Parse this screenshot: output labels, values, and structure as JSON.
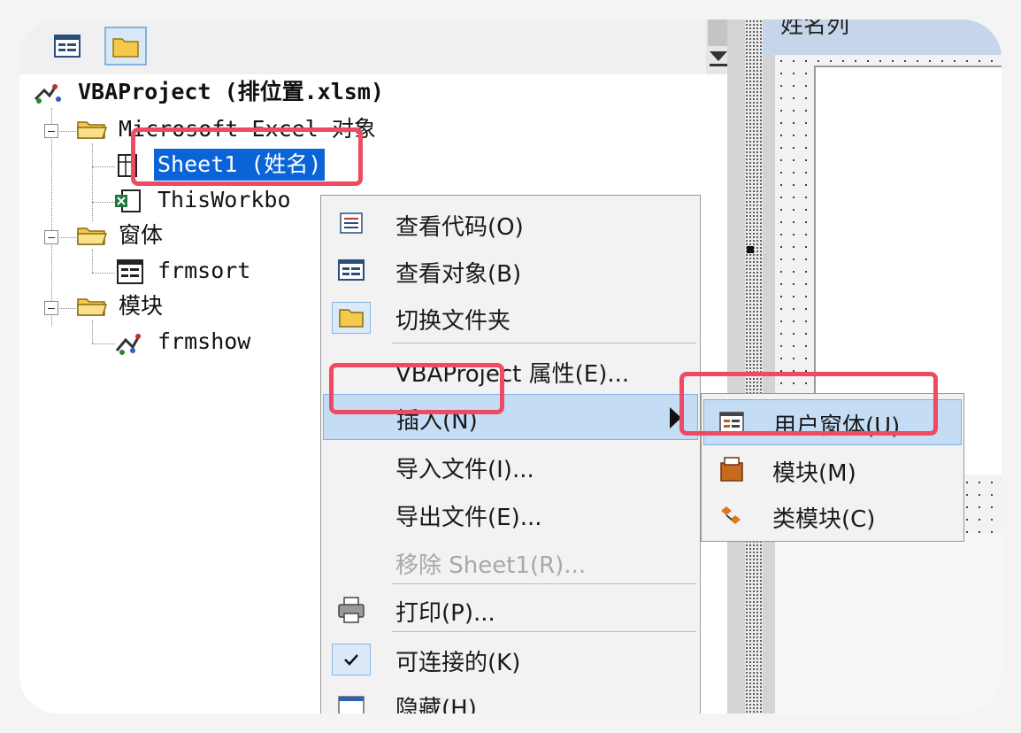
{
  "colors": {
    "selection": "#0a64d8",
    "highlight": "#c5dcf5",
    "annotation": "#ef4a63",
    "menu_bg": "#f2f2f2"
  },
  "toolbar": {
    "buttons": [
      {
        "icon": "view-object-icon"
      },
      {
        "icon": "toggle-folders-icon",
        "pressed": true
      }
    ]
  },
  "right_pane": {
    "form_caption": "姓名列"
  },
  "tree": {
    "project": "VBAProject (排位置.xlsm)",
    "excel_objects_folder": "Microsoft Excel 对象",
    "sheet1": "Sheet1 (姓名)",
    "workbook": "ThisWorkbo",
    "forms_folder": "窗体",
    "form1": "frmsort",
    "modules_folder": "模块",
    "module1": "frmshow"
  },
  "context_menu": {
    "items": [
      {
        "label": "查看代码(O)",
        "icon": "view-code-icon"
      },
      {
        "label": "查看对象(B)",
        "icon": "view-object-icon"
      },
      {
        "label": "切换文件夹",
        "icon": "folder-icon",
        "checked": true
      },
      {
        "label": "VBAProject 属性(E)..."
      },
      {
        "label": "插入(N)",
        "highlighted": true,
        "has_submenu": true
      },
      {
        "label": "导入文件(I)..."
      },
      {
        "label": "导出文件(E)..."
      },
      {
        "label": "移除 Sheet1(R)...",
        "disabled": true
      },
      {
        "label": "打印(P)...",
        "icon": "printer-icon"
      },
      {
        "label": "可连接的(K)",
        "icon": "checkmark-icon",
        "checked": true
      },
      {
        "label": "隐藏(H)",
        "icon": "window-icon"
      }
    ]
  },
  "submenu": {
    "items": [
      {
        "label": "用户窗体(U)",
        "icon": "userform-icon",
        "highlighted": true
      },
      {
        "label": "模块(M)",
        "icon": "module-icon"
      },
      {
        "label": "类模块(C)",
        "icon": "class-module-icon"
      }
    ]
  }
}
